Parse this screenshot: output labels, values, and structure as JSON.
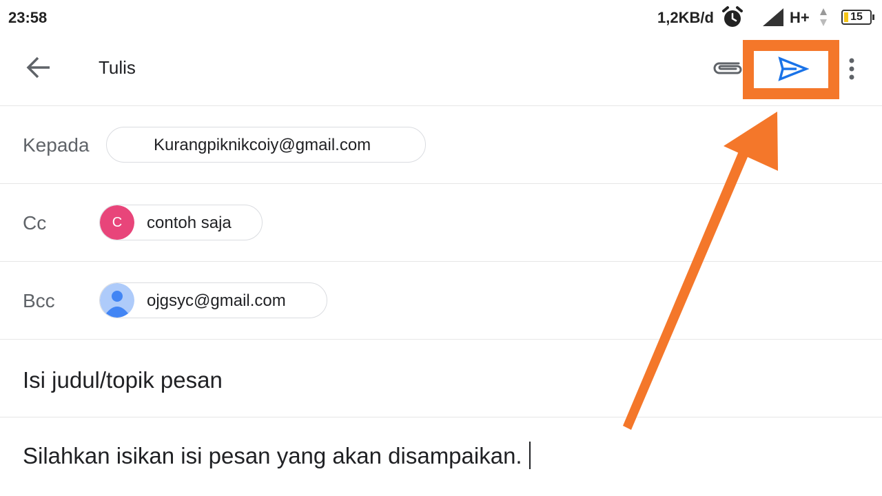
{
  "status_bar": {
    "time": "23:58",
    "network_speed": "1,2KB/d",
    "network_type": "H+",
    "battery_level": "15",
    "icons": [
      "alarm-icon",
      "signal-icon",
      "data-arrows-icon",
      "battery-icon"
    ]
  },
  "app_bar": {
    "title": "Tulis",
    "icons": [
      "back-arrow-icon",
      "paperclip-icon",
      "send-icon",
      "more-vert-icon"
    ]
  },
  "compose": {
    "to": {
      "label": "Kepada",
      "recipient": "Kurangpiknikcoiy@gmail.com"
    },
    "cc": {
      "label": "Cc",
      "recipient": "contoh saja",
      "avatar_letter": "C"
    },
    "bcc": {
      "label": "Bcc",
      "recipient": "ojgsyc@gmail.com"
    },
    "subject": "Isi judul/topik pesan",
    "body": "Silahkan isikan isi pesan yang akan disampaikan."
  },
  "colors": {
    "annotation": "#f4772a",
    "send_icon": "#1a73e8",
    "avatar_cc": "#e8457a",
    "avatar_bcc_bg": "#aecbfa",
    "avatar_bcc_fg": "#4285f4"
  }
}
